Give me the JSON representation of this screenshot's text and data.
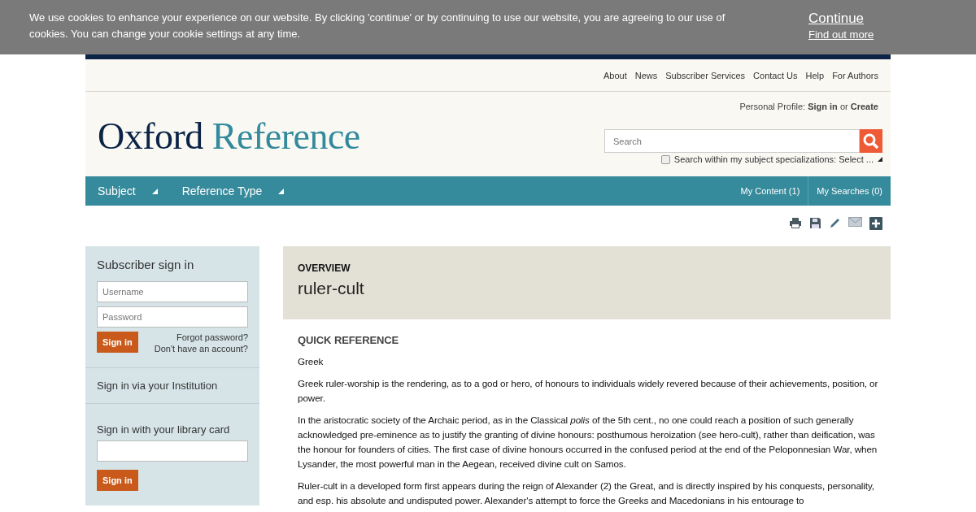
{
  "cookie_banner": {
    "message": "We use cookies to enhance your experience on our website. By clicking 'continue' or by continuing to use our website, you are agreeing to our use of cookies. You can change your cookie settings at any time.",
    "continue": "Continue",
    "find_out_more": "Find out more"
  },
  "top_links": [
    "About",
    "News",
    "Subscriber Services",
    "Contact Us",
    "Help",
    "For Authors"
  ],
  "profile": {
    "label": "Personal Profile:",
    "sign_in": "Sign in",
    "or": "or",
    "create": "Create"
  },
  "logo": {
    "first": "Oxford",
    "second": "Reference"
  },
  "search": {
    "placeholder": "Search",
    "specialization": {
      "checked": false,
      "label": "Search within my subject specializations: Select ..."
    }
  },
  "nav": {
    "menus": [
      "Subject",
      "Reference Type"
    ],
    "right": [
      "My Content (1)",
      "My Searches (0)"
    ]
  },
  "sidebar": {
    "subscriber": {
      "title": "Subscriber sign in",
      "username_placeholder": "Username",
      "password_placeholder": "Password",
      "button": "Sign in",
      "forgot": "Forgot password?",
      "no_account": "Don't have an account?"
    },
    "institution": "Sign in via your Institution",
    "library": {
      "title": "Sign in with your library card",
      "button": "Sign in"
    }
  },
  "overview": {
    "label": "OVERVIEW",
    "title": "ruler-cult"
  },
  "quick_reference": {
    "heading": "QUICK REFERENCE",
    "subject": "Greek",
    "paragraphs": [
      "Greek ruler-worship is the rendering, as to a god or hero, of honours to individuals widely revered because of their achievements, position, or power.",
      "In the aristocratic society of the Archaic period, as in the Classical *polis* of the 5th cent., no one could reach a position of such generally acknowledged pre-eminence as to justify the granting of divine honours: posthumous heroization (see hero-cult), rather than deification, was the honour for founders of cities. The first case of divine honours occurred in the confused period at the end of the Peloponnesian War, when Lysander, the most powerful man in the Aegean, received divine cult on Samos.",
      "Ruler-cult in a developed form first appears during the reign of Alexander (2) the Great, and is directly inspired by his conquests, personality, and esp. his absolute and undisputed power. Alexander's attempt to force the Greeks and Macedonians in his entourage to"
    ]
  }
}
